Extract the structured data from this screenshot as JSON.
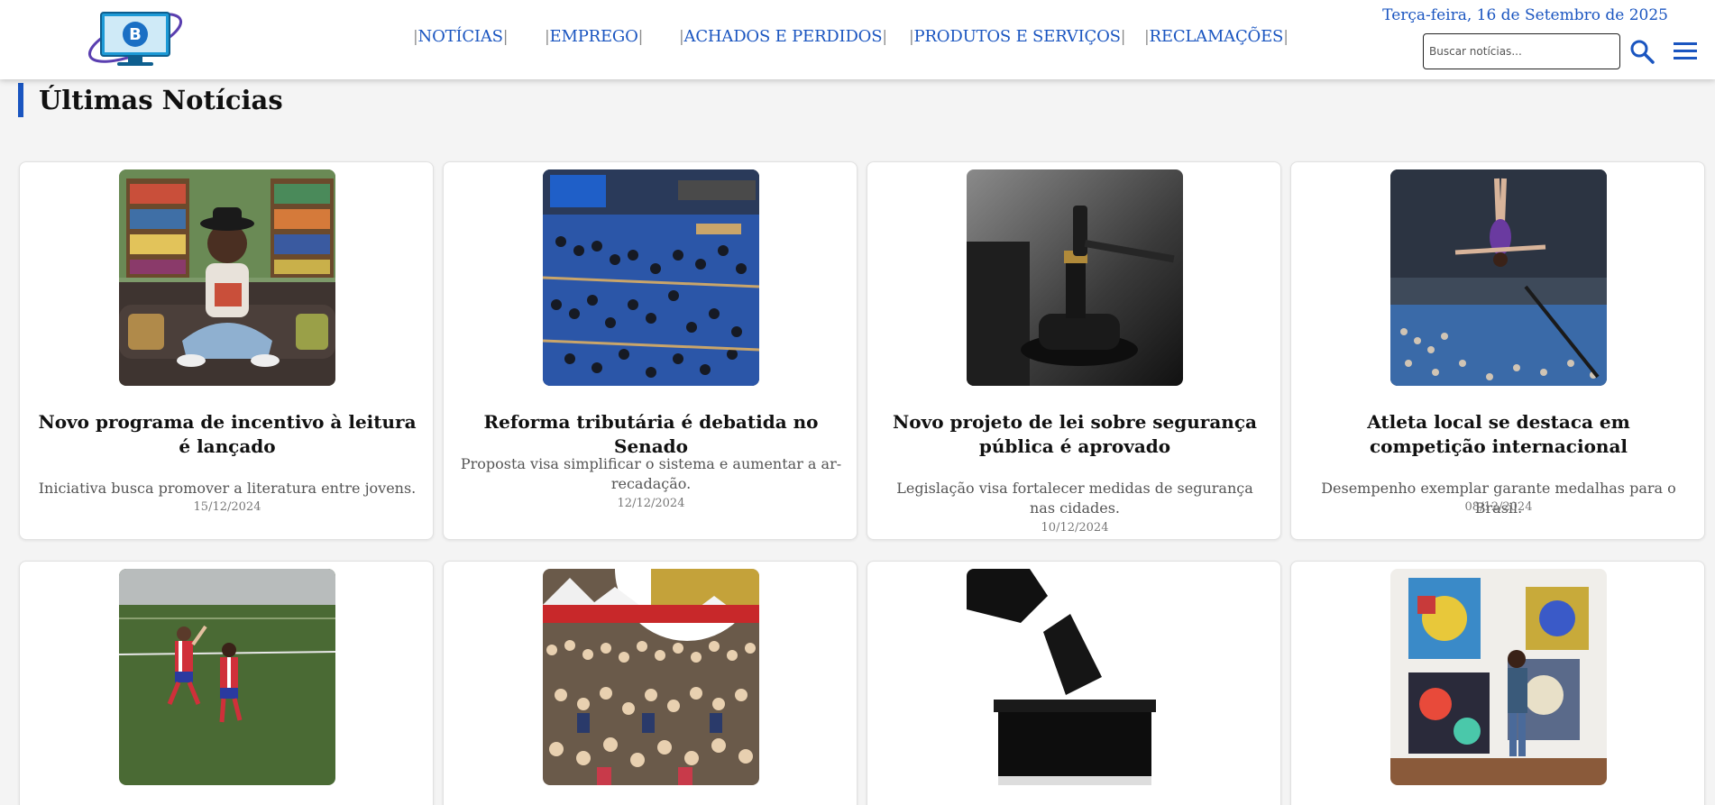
{
  "header": {
    "logo_letter": "B",
    "nav": [
      {
        "label": "NOTÍCIAS",
        "pre": "|",
        "post": "|"
      },
      {
        "label": "EMPREGO",
        "pre": "|",
        "post": "|"
      },
      {
        "label": "ACHADOS E PERDIDOS",
        "pre": "|",
        "post": "|"
      },
      {
        "label": "PRODUTOS E SERVIÇOS",
        "pre": "|",
        "post": "|"
      },
      {
        "label": "RECLAMAÇÕES",
        "pre": "|",
        "post": "|"
      }
    ],
    "date": "Terça-feira, 16 de Setembro de 2025",
    "search_placeholder": "Buscar notícias...",
    "accent_color": "#1a55c0"
  },
  "section": {
    "title": "Últimas Notícias"
  },
  "news": [
    {
      "title": "Novo programa de incentivo à leitura é lançado",
      "description": "Iniciativa busca promover a literatura entre jovens.",
      "date": "15/12/2024",
      "image": "woman-reading-book"
    },
    {
      "title": "Reforma tributária é debatida no Senado",
      "description": "Proposta visa simplificar o sistema e aumentar a ar-recadação.",
      "date": "12/12/2024",
      "image": "senate-plenary"
    },
    {
      "title": "Novo projeto de lei sobre segurança pública é aprovado",
      "description": "Legislação visa fortalecer medidas de segurança nas cidades.",
      "date": "10/12/2024",
      "image": "judge-gavel"
    },
    {
      "title": "Atleta local se destaca em competição internacional",
      "description": "Desempenho exemplar garante medalhas para o Brasil.",
      "date": "08/12/2024",
      "image": "gymnast-jump"
    },
    {
      "title": "",
      "description": "",
      "date": "",
      "image": "soccer-players"
    },
    {
      "title": "",
      "description": "",
      "date": "",
      "image": "festival-crowd"
    },
    {
      "title": "",
      "description": "",
      "date": "",
      "image": "ballot-box"
    },
    {
      "title": "",
      "description": "",
      "date": "",
      "image": "art-exhibition"
    }
  ]
}
